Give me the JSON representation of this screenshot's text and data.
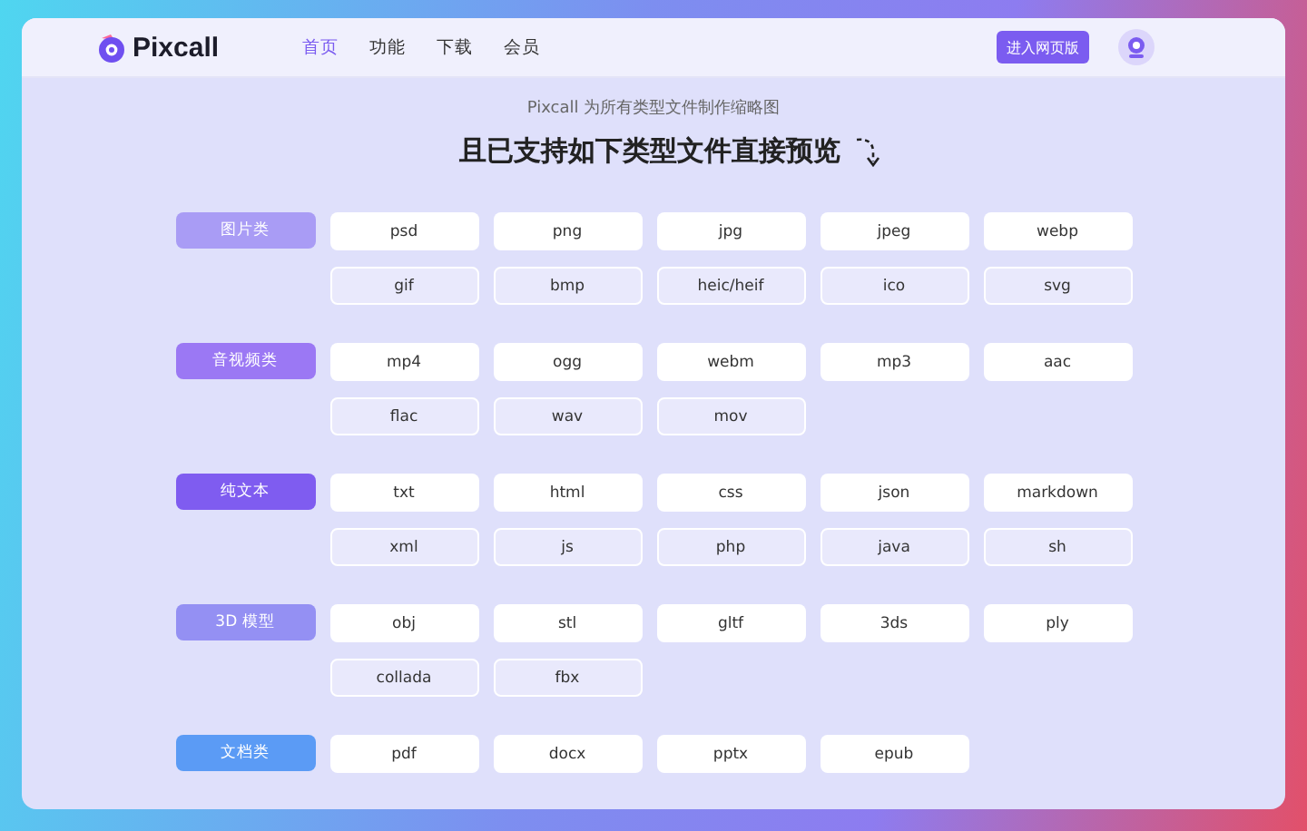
{
  "header": {
    "logo": "Pixcall",
    "nav": [
      {
        "label": "首页",
        "selected": true
      },
      {
        "label": "功能",
        "selected": false
      },
      {
        "label": "下载",
        "selected": false
      },
      {
        "label": "会员",
        "selected": false
      }
    ],
    "button": "进入网页版"
  },
  "subtitle": "Pixcall 为所有类型文件制作缩略图",
  "title": "且已支持如下类型文件直接预览",
  "groups": [
    {
      "label": "图片类",
      "color": "#a99cf5",
      "rows": [
        [
          "psd",
          "png",
          "jpg",
          "jpeg",
          "webp"
        ],
        [
          "gif",
          "bmp",
          "heic/heif",
          "ico",
          "svg"
        ]
      ]
    },
    {
      "label": "音视频类",
      "color": "#9b78f4",
      "rows": [
        [
          "mp4",
          "ogg",
          "webm",
          "mp3",
          "aac"
        ],
        [
          "flac",
          "wav",
          "mov"
        ]
      ]
    },
    {
      "label": "纯文本",
      "color": "#7f5cf0",
      "rows": [
        [
          "txt",
          "html",
          "css",
          "json",
          "markdown"
        ],
        [
          "xml",
          "js",
          "php",
          "java",
          "sh"
        ]
      ]
    },
    {
      "label": "3D 模型",
      "color": "#9490f3",
      "rows": [
        [
          "obj",
          "stl",
          "gltf",
          "3ds",
          "ply"
        ],
        [
          "collada",
          "fbx"
        ]
      ]
    },
    {
      "label": "文档类",
      "color": "#5b9bf5",
      "rows": [
        [
          "pdf",
          "docx",
          "pptx",
          "epub"
        ]
      ]
    }
  ]
}
